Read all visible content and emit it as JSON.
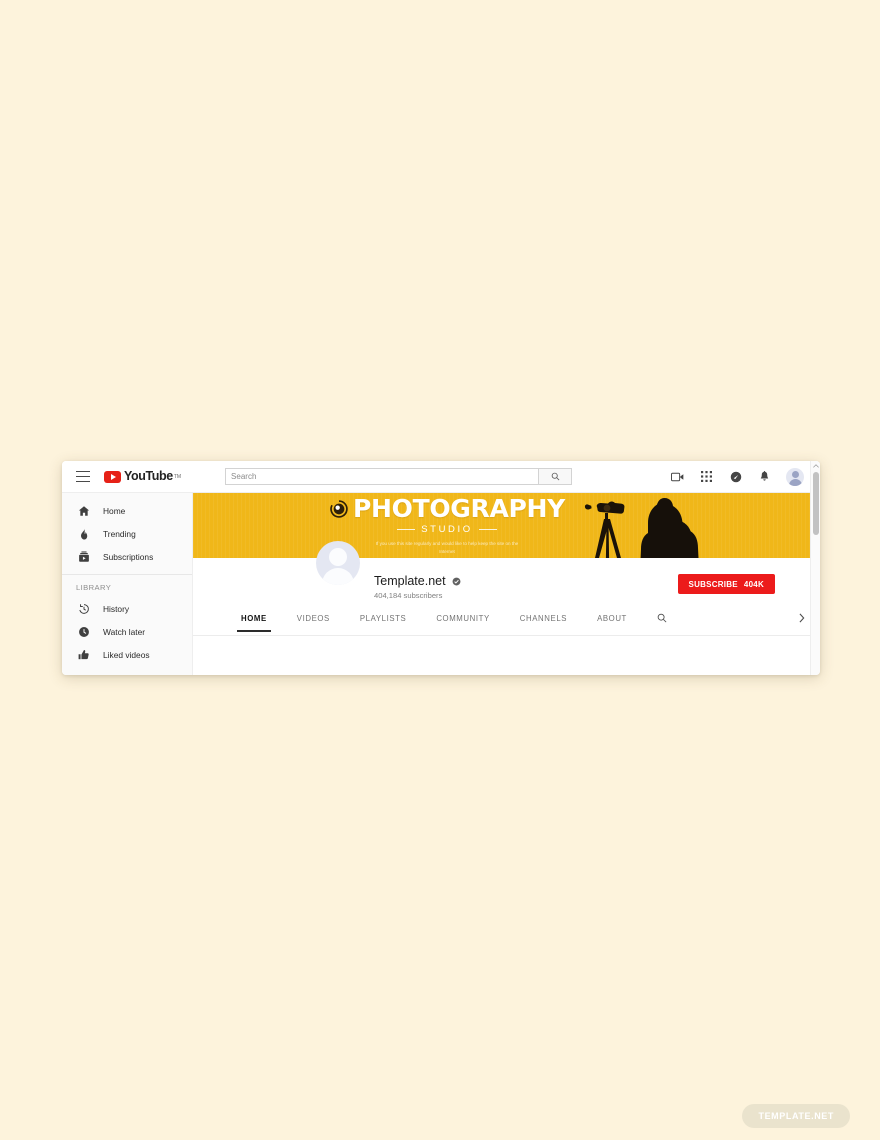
{
  "page": {
    "background_color": "#fdf3dc",
    "watermark": "TEMPLATE.NET"
  },
  "header": {
    "menu_icon": "hamburger-icon",
    "logo_text": "YouTube",
    "logo_tm": "TM",
    "search": {
      "placeholder": "Search",
      "value": "",
      "button_icon": "search-icon"
    },
    "icons": [
      {
        "name": "create-video-icon",
        "label": "Create"
      },
      {
        "name": "apps-grid-icon",
        "label": "YouTube apps"
      },
      {
        "name": "messages-icon",
        "label": "Messages"
      },
      {
        "name": "notifications-bell-icon",
        "label": "Notifications"
      }
    ],
    "avatar": "account-avatar"
  },
  "sidebar": {
    "primary": [
      {
        "label": "Home",
        "icon": "home-icon"
      },
      {
        "label": "Trending",
        "icon": "flame-icon"
      },
      {
        "label": "Subscriptions",
        "icon": "subscriptions-icon"
      }
    ],
    "library_heading": "LIBRARY",
    "library": [
      {
        "label": "History",
        "icon": "history-icon"
      },
      {
        "label": "Watch later",
        "icon": "clock-icon"
      },
      {
        "label": "Liked videos",
        "icon": "thumbs-up-icon"
      }
    ]
  },
  "banner": {
    "title": "PHOTOGRAPHY",
    "subtitle": "STUDIO",
    "tagline": "If you use this site regularly and would like to help keep the site on the Internet",
    "background_color": "#f0b719",
    "lens_icon": "camera-lens-icon",
    "photographer_silhouette": "photographer-silhouette",
    "tripod_silhouette": "camera-tripod-silhouette"
  },
  "channel": {
    "avatar": "channel-avatar",
    "name": "Template.net",
    "verified_icon": "verified-badge-icon",
    "subscribers": "404,184 subscribers",
    "subscribe": {
      "label": "SUBSCRIBE",
      "count": "404K",
      "color": "#ec1b1b"
    }
  },
  "tabs": {
    "items": [
      {
        "label": "HOME",
        "active": true
      },
      {
        "label": "VIDEOS",
        "active": false
      },
      {
        "label": "PLAYLISTS",
        "active": false
      },
      {
        "label": "COMMUNITY",
        "active": false
      },
      {
        "label": "CHANNELS",
        "active": false
      },
      {
        "label": "ABOUT",
        "active": false
      }
    ],
    "search_icon": "search-icon",
    "overflow_icon": "chevron-right-icon"
  },
  "scrollbar": {
    "up_icon": "caret-up-icon",
    "thumb": "scrollbar-thumb"
  }
}
